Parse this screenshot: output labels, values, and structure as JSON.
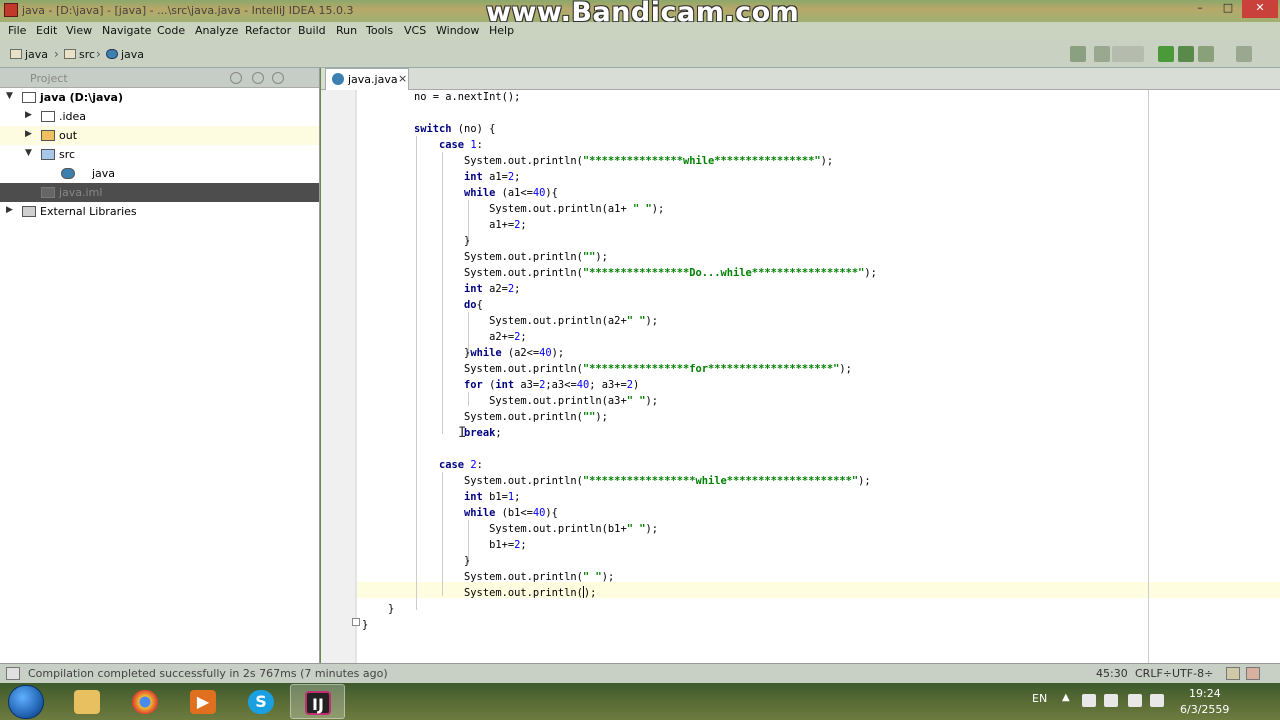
{
  "window": {
    "title": "java - [D:\\java] - [java] - ...\\src\\java.java - IntelliJ IDEA 15.0.3",
    "watermark": "www.Bandicam.com",
    "min": "–",
    "max": "□",
    "close": "✕"
  },
  "menu": [
    "File",
    "Edit",
    "View",
    "Navigate",
    "Code",
    "Analyze",
    "Refactor",
    "Build",
    "Run",
    "Tools",
    "VCS",
    "Window",
    "Help"
  ],
  "breadcrumb": [
    "java",
    "src",
    "java"
  ],
  "project": {
    "header": "Project",
    "tree": [
      {
        "label": "java (D:\\java)"
      },
      {
        "label": ".idea"
      },
      {
        "label": "out"
      },
      {
        "label": "src"
      },
      {
        "label": "java"
      },
      {
        "label": "java.iml"
      },
      {
        "label": "External Libraries"
      }
    ]
  },
  "editor": {
    "tab": "java.java",
    "tab_close": "×",
    "lines": [
      [
        {
          "t": "no = a.nextInt();"
        }
      ],
      [],
      [
        {
          "t": "switch",
          "c": "kw"
        },
        {
          "t": " (no) {"
        }
      ],
      [
        {
          "t": "    "
        },
        {
          "t": "case",
          "c": "kw"
        },
        {
          "t": " "
        },
        {
          "t": "1",
          "c": "num"
        },
        {
          "t": ":"
        }
      ],
      [
        {
          "t": "        System.out.println("
        },
        {
          "t": "\"***************while****************\"",
          "c": "str"
        },
        {
          "t": ");"
        }
      ],
      [
        {
          "t": "        "
        },
        {
          "t": "int",
          "c": "kw"
        },
        {
          "t": " a1="
        },
        {
          "t": "2",
          "c": "num"
        },
        {
          "t": ";"
        }
      ],
      [
        {
          "t": "        "
        },
        {
          "t": "while",
          "c": "kw"
        },
        {
          "t": " (a1<="
        },
        {
          "t": "40",
          "c": "num"
        },
        {
          "t": "){"
        }
      ],
      [
        {
          "t": "            System.out.println(a1+ "
        },
        {
          "t": "\" \"",
          "c": "str"
        },
        {
          "t": ");"
        }
      ],
      [
        {
          "t": "            a1+="
        },
        {
          "t": "2",
          "c": "num"
        },
        {
          "t": ";"
        }
      ],
      [
        {
          "t": "        }"
        }
      ],
      [
        {
          "t": "        System.out.println("
        },
        {
          "t": "\"\"",
          "c": "str"
        },
        {
          "t": ");"
        }
      ],
      [
        {
          "t": "        System.out.println("
        },
        {
          "t": "\"****************Do...while*****************\"",
          "c": "str"
        },
        {
          "t": ");"
        }
      ],
      [
        {
          "t": "        "
        },
        {
          "t": "int",
          "c": "kw"
        },
        {
          "t": " a2="
        },
        {
          "t": "2",
          "c": "num"
        },
        {
          "t": ";"
        }
      ],
      [
        {
          "t": "        "
        },
        {
          "t": "do",
          "c": "kw"
        },
        {
          "t": "{"
        }
      ],
      [
        {
          "t": "            System.out.println(a2+"
        },
        {
          "t": "\" \"",
          "c": "str"
        },
        {
          "t": ");"
        }
      ],
      [
        {
          "t": "            a2+="
        },
        {
          "t": "2",
          "c": "num"
        },
        {
          "t": ";"
        }
      ],
      [
        {
          "t": "        }"
        },
        {
          "t": "while",
          "c": "kw"
        },
        {
          "t": " (a2<="
        },
        {
          "t": "40",
          "c": "num"
        },
        {
          "t": ");"
        }
      ],
      [
        {
          "t": "        System.out.println("
        },
        {
          "t": "\"****************for********************\"",
          "c": "str"
        },
        {
          "t": ");"
        }
      ],
      [
        {
          "t": "        "
        },
        {
          "t": "for",
          "c": "kw"
        },
        {
          "t": " ("
        },
        {
          "t": "int",
          "c": "kw"
        },
        {
          "t": " a3="
        },
        {
          "t": "2",
          "c": "num"
        },
        {
          "t": ";a3<="
        },
        {
          "t": "40",
          "c": "num"
        },
        {
          "t": "; a3+="
        },
        {
          "t": "2",
          "c": "num"
        },
        {
          "t": ")"
        }
      ],
      [
        {
          "t": "            System.out.println(a3+"
        },
        {
          "t": "\" \"",
          "c": "str"
        },
        {
          "t": ");"
        }
      ],
      [
        {
          "t": "        System.out.println("
        },
        {
          "t": "\"\"",
          "c": "str"
        },
        {
          "t": ");"
        }
      ],
      [
        {
          "t": "        "
        },
        {
          "t": "break",
          "c": "kw"
        },
        {
          "t": ";"
        }
      ],
      [],
      [
        {
          "t": "    "
        },
        {
          "t": "case",
          "c": "kw"
        },
        {
          "t": " "
        },
        {
          "t": "2",
          "c": "num"
        },
        {
          "t": ":"
        }
      ],
      [
        {
          "t": "        System.out.println("
        },
        {
          "t": "\"*****************while********************\"",
          "c": "str"
        },
        {
          "t": ");"
        }
      ],
      [
        {
          "t": "        "
        },
        {
          "t": "int",
          "c": "kw"
        },
        {
          "t": " b1="
        },
        {
          "t": "1",
          "c": "num"
        },
        {
          "t": ";"
        }
      ],
      [
        {
          "t": "        "
        },
        {
          "t": "while",
          "c": "kw"
        },
        {
          "t": " (b1<="
        },
        {
          "t": "40",
          "c": "num"
        },
        {
          "t": "){"
        }
      ],
      [
        {
          "t": "            System.out.println(b1+"
        },
        {
          "t": "\" \"",
          "c": "str"
        },
        {
          "t": ");"
        }
      ],
      [
        {
          "t": "            b1+="
        },
        {
          "t": "2",
          "c": "num"
        },
        {
          "t": ";"
        }
      ],
      [
        {
          "t": "        }"
        }
      ],
      [
        {
          "t": "        System.out.println("
        },
        {
          "t": "\" \"",
          "c": "str"
        },
        {
          "t": ");"
        }
      ],
      [
        {
          "t": "        System.out.println("
        },
        {
          "t": "CARET"
        },
        {
          "t": ");"
        }
      ],
      [
        {
          "t": "}"
        }
      ],
      [
        {
          "t": "}"
        }
      ],
      [
        {
          "t": "}"
        }
      ]
    ]
  },
  "status": {
    "message": "Compilation completed successfully in 2s 767ms (7 minutes ago)",
    "position": "45:30",
    "line_sep": "CRLF÷",
    "encoding": "UTF-8÷"
  },
  "taskbar": {
    "apps": [
      "file-explorer",
      "chrome",
      "media-player",
      "skype",
      "intellij"
    ],
    "lang": "EN",
    "tray_up": "▲",
    "time": "19:24",
    "date": "6/3/2559"
  }
}
